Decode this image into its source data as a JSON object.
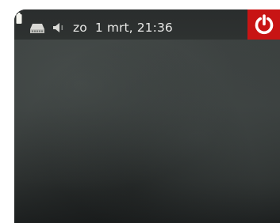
{
  "panel": {
    "indicators": {
      "battery": {
        "icon": "battery-icon",
        "color": "#f4f4ee"
      },
      "network": {
        "icon": "network-icon",
        "color": "#d8d8d4"
      },
      "sound": {
        "icon": "speaker-icon",
        "color": "#d8d8d4"
      }
    },
    "clock": {
      "day": "zo",
      "date_time": "1 mrt, 21:36"
    },
    "power": {
      "icon": "power-icon",
      "color": "#c81414"
    }
  }
}
